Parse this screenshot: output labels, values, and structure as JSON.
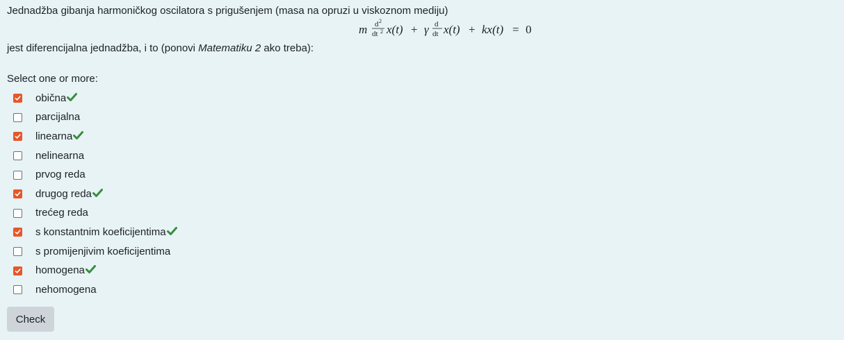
{
  "question": {
    "line1": "Jednadžba gibanja harmoničkog oscilatora s prigušenjem (masa na opruzi u viskoznom mediju)",
    "line2_before": "jest diferencijalna jednadžba, i to (ponovi ",
    "line2_emph": "Matematiku 2",
    "line2_after": " ako treba):",
    "formula": {
      "m": "m",
      "d2": "d",
      "d2_exp": "2",
      "dt2": "dt",
      "dt2_exp": "2",
      "x_t_1": "x(t)",
      "plus1": "+",
      "gamma": "γ",
      "d1": "d",
      "dt1": "dt",
      "x_t_2": "x(t)",
      "plus2": "+",
      "kx_t": "kx(t)",
      "equals": "=",
      "zero": "0"
    }
  },
  "prompt": "Select one or more:",
  "options": [
    {
      "label": "obična",
      "checked": true,
      "correct": true
    },
    {
      "label": "parcijalna",
      "checked": false,
      "correct": false
    },
    {
      "label": "linearna",
      "checked": true,
      "correct": true
    },
    {
      "label": "nelinearna",
      "checked": false,
      "correct": false
    },
    {
      "label": "prvog reda",
      "checked": false,
      "correct": false
    },
    {
      "label": "drugog reda",
      "checked": true,
      "correct": true
    },
    {
      "label": "trećeg reda",
      "checked": false,
      "correct": false
    },
    {
      "label": "s konstantnim koeficijentima",
      "checked": true,
      "correct": true
    },
    {
      "label": "s promijenjivim koeficijentima",
      "checked": false,
      "correct": false
    },
    {
      "label": "homogena",
      "checked": true,
      "correct": true
    },
    {
      "label": "nehomogena",
      "checked": false,
      "correct": false
    }
  ],
  "check_button": "Check",
  "colors": {
    "background": "#e7f3f5",
    "checkbox_checked": "#e8562a",
    "correct_tick": "#3a8c3f",
    "button": "#ced4da"
  },
  "icons": {
    "correct": "check-icon",
    "checkbox_mark": "checkmark-icon"
  }
}
